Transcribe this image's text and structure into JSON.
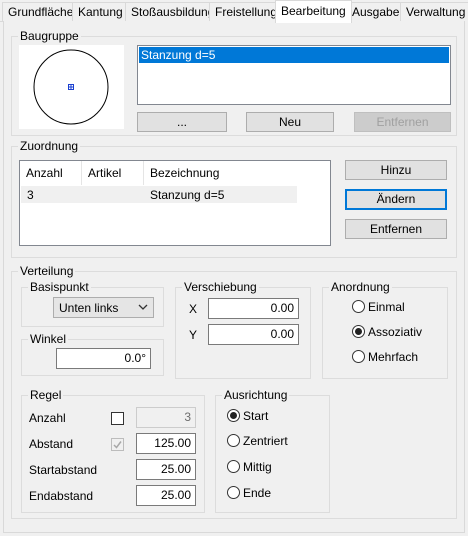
{
  "tabs": [
    "Grundfläche",
    "Kantung",
    "Stoßausbildung",
    "Freistellung",
    "Bearbeitung",
    "Ausgabe",
    "Verwaltung"
  ],
  "baugruppe": {
    "title": "Baugruppe",
    "list_items": [
      "Stanzung d=5"
    ],
    "btn_browse": "...",
    "btn_new": "Neu",
    "btn_remove": "Entfernen"
  },
  "zuordnung": {
    "title": "Zuordnung",
    "columns": [
      "Anzahl",
      "Artikel",
      "Bezeichnung"
    ],
    "rows": [
      {
        "anzahl": "3",
        "artikel": "",
        "bezeichnung": "Stanzung d=5"
      }
    ],
    "btn_add": "Hinzu",
    "btn_change": "Ändern",
    "btn_remove": "Entfernen"
  },
  "verteilung": {
    "title": "Verteilung",
    "basispunkt": {
      "title": "Basispunkt",
      "value": "Unten links"
    },
    "winkel": {
      "title": "Winkel",
      "value": "0.0°"
    },
    "verschiebung": {
      "title": "Verschiebung",
      "x_label": "X",
      "x_value": "0.00",
      "y_label": "Y",
      "y_value": "0.00"
    },
    "anordnung": {
      "title": "Anordnung",
      "options": [
        "Einmal",
        "Assoziativ",
        "Mehrfach"
      ],
      "selected": "Assoziativ"
    },
    "regel": {
      "title": "Regel",
      "anzahl_label": "Anzahl",
      "anzahl_value": "3",
      "abstand_label": "Abstand",
      "abstand_value": "125.00",
      "startabstand_label": "Startabstand",
      "startabstand_value": "25.00",
      "endabstand_label": "Endabstand",
      "endabstand_value": "25.00"
    },
    "ausrichtung": {
      "title": "Ausrichtung",
      "options": [
        "Start",
        "Zentriert",
        "Mittig",
        "Ende"
      ],
      "selected": "Start"
    }
  },
  "colors": {
    "selection": "#0078d7",
    "panel": "#f0f0f0",
    "preview_marker": "#1a3fd0"
  }
}
